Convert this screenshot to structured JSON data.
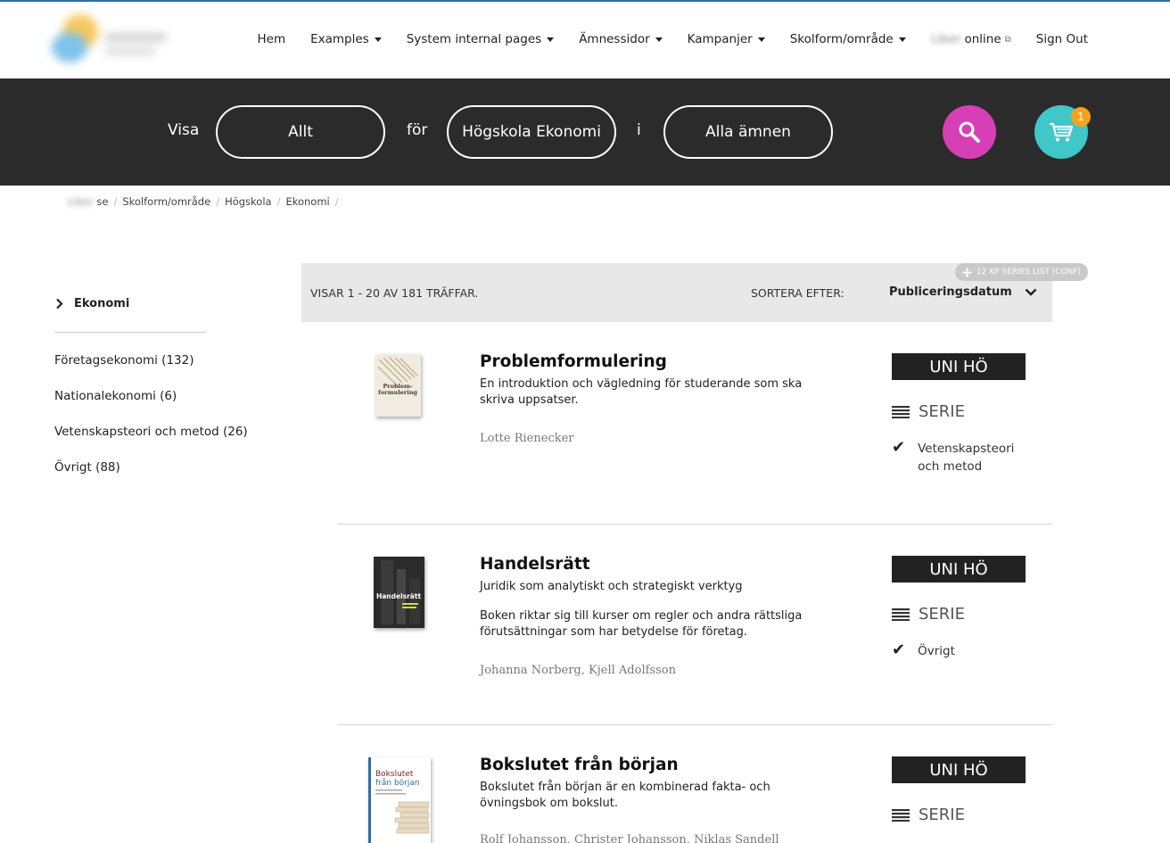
{
  "header": {
    "logo_label": "Liber logo",
    "nav": [
      {
        "label": "Hem",
        "caret": false
      },
      {
        "label": "Examples",
        "caret": true
      },
      {
        "label": "System internal pages",
        "caret": true
      },
      {
        "label": "Ämnessidor",
        "caret": true
      },
      {
        "label": "Kampanjer",
        "caret": true
      },
      {
        "label": "Skolform/område",
        "caret": true
      }
    ],
    "online_prefix": "Liber",
    "online_label": "online",
    "signout_label": "Sign Out"
  },
  "searchbar": {
    "visa_label": "Visa",
    "type_value": "Allt",
    "for_label": "för",
    "level_value": "Högskola Ekonomi",
    "in_label": "i",
    "subject_value": "Alla ämnen",
    "cart_count": "1"
  },
  "breadcrumb": {
    "home_blurred": "Liber",
    "home_suffix": "se",
    "items": [
      "Skolform/område",
      "Högskola",
      "Ekonomi"
    ]
  },
  "sidebar": {
    "active": "Ekonomi",
    "items": [
      "Företagsekonomi (132)",
      "Nationalekonomi (6)",
      "Vetenskapsteori och metod (26)",
      "Övrigt (88)"
    ]
  },
  "results": {
    "count_text": "VISAR 1 - 20 AV 181 TRÄFFAR.",
    "sort_label": "SORTERA EFTER:",
    "sort_value": "Publiceringsdatum",
    "conf_tag": "12 KP SERIES LIST (CONF)"
  },
  "books": [
    {
      "title": "Problemformulering",
      "desc1": "En introduktion och vägledning för studerande som ska skriva uppsatser.",
      "desc2": "",
      "author": "Lotte Rienecker",
      "badge": "UNI HÖ",
      "serie": "SERIE",
      "subject": "Vetenskapsteori och metod",
      "cover_text": "Problem-formulering"
    },
    {
      "title": "Handelsrätt",
      "desc1": "Juridik som analytiskt och strategiskt verktyg",
      "desc2": "Boken riktar sig till kurser om regler och andra rättsliga förutsättningar som har betydelse för företag.",
      "author": "Johanna Norberg, Kjell Adolfsson",
      "badge": "UNI HÖ",
      "serie": "SERIE",
      "subject": "Övrigt",
      "cover_text": "Handelsrätt"
    },
    {
      "title": "Bokslutet från början",
      "desc1": "Bokslutet från början är en kombinerad fakta- och övningsbok om bokslut.",
      "desc2": "",
      "author": "Rolf Johansson, Christer Johansson, Niklas Sandell",
      "badge": "UNI HÖ",
      "serie": "SERIE",
      "subject": "",
      "cover_text": "Bokslutet från början"
    }
  ],
  "colors": {
    "search_bg": "#2b2b2b",
    "search_button": "#d63fb6",
    "cart_button": "#3fc7c9",
    "cart_badge": "#f4a41c"
  }
}
